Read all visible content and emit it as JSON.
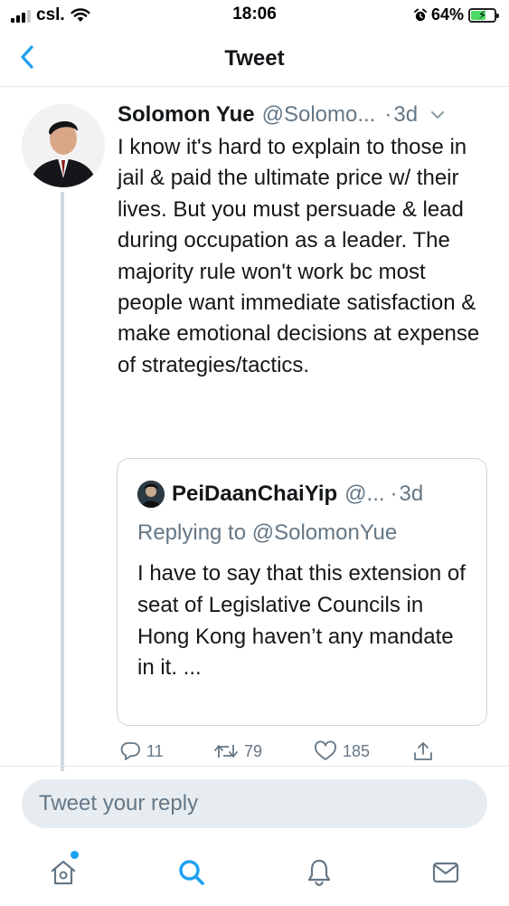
{
  "status_bar": {
    "carrier": "csl.",
    "time": "18:06",
    "battery_percent": "64%",
    "battery_level": 0.64
  },
  "nav": {
    "title": "Tweet"
  },
  "tweet": {
    "author_name": "Solomon Yue",
    "author_handle": "@Solomo...",
    "dot": "·",
    "time": "3d",
    "text": "I know it's hard to explain to those in jail & paid the ultimate price w/ their lives. But you must persuade & lead during occupation as a leader. The majority rule won't work bc most people want immediate satisfaction & make emotional decisions at expense of strategies/tactics.",
    "quoted": {
      "author_name": "PeiDaanChaiYip",
      "author_handle": "@...",
      "dot": "·",
      "time": "3d",
      "replying_to": "Replying to @SolomonYue",
      "text": "I have to say that this extension of seat of Legislative Councils in Hong Kong haven’t any mandate in it. ..."
    },
    "stats": {
      "replies": "11",
      "retweets": "79",
      "likes": "185"
    }
  },
  "reply": {
    "placeholder": "Tweet your reply"
  },
  "tabbar": {
    "active_tab": "search",
    "home_has_notification": true
  },
  "colors": {
    "accent": "#1da1f2",
    "secondary_text": "#657786",
    "thread_line": "#cfd9de",
    "battery": "#4cd964"
  }
}
